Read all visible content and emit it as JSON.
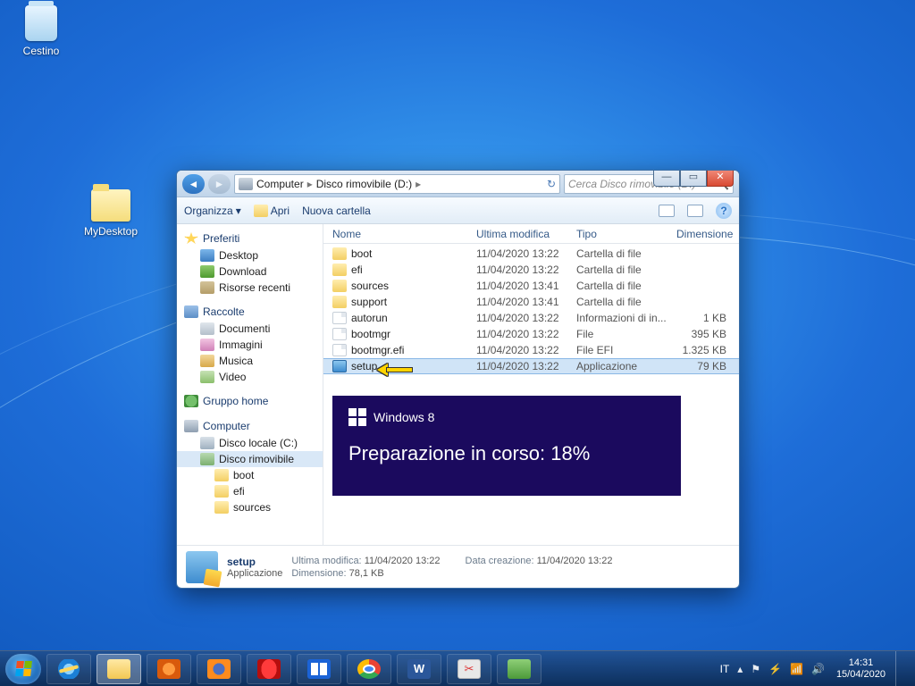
{
  "desktop": {
    "recycle_label": "Cestino",
    "mydesktop_label": "MyDesktop"
  },
  "window": {
    "nav": {
      "computer": "Computer",
      "drive": "Disco rimovibile (D:)"
    },
    "search_placeholder": "Cerca Disco rimovibile (D:)",
    "toolbar": {
      "organize": "Organizza",
      "open": "Apri",
      "new_folder": "Nuova cartella"
    },
    "columns": {
      "name": "Nome",
      "modified": "Ultima modifica",
      "type": "Tipo",
      "size": "Dimensione"
    },
    "sidebar": {
      "favorites": "Preferiti",
      "desktop": "Desktop",
      "download": "Download",
      "recent": "Risorse recenti",
      "libraries": "Raccolte",
      "documents": "Documenti",
      "images": "Immagini",
      "music": "Musica",
      "video": "Video",
      "homegroup": "Gruppo home",
      "computer": "Computer",
      "local_disk": "Disco locale (C:)",
      "removable": "Disco rimovibile",
      "boot": "boot",
      "efi": "efi",
      "sources": "sources"
    },
    "files": [
      {
        "name": "boot",
        "modified": "11/04/2020 13:22",
        "type": "Cartella di file",
        "size": "",
        "icon": "folder"
      },
      {
        "name": "efi",
        "modified": "11/04/2020 13:22",
        "type": "Cartella di file",
        "size": "",
        "icon": "folder"
      },
      {
        "name": "sources",
        "modified": "11/04/2020 13:41",
        "type": "Cartella di file",
        "size": "",
        "icon": "folder"
      },
      {
        "name": "support",
        "modified": "11/04/2020 13:41",
        "type": "Cartella di file",
        "size": "",
        "icon": "folder"
      },
      {
        "name": "autorun",
        "modified": "11/04/2020 13:22",
        "type": "Informazioni di in...",
        "size": "1 KB",
        "icon": "file"
      },
      {
        "name": "bootmgr",
        "modified": "11/04/2020 13:22",
        "type": "File",
        "size": "395 KB",
        "icon": "file"
      },
      {
        "name": "bootmgr.efi",
        "modified": "11/04/2020 13:22",
        "type": "File EFI",
        "size": "1.325 KB",
        "icon": "file"
      },
      {
        "name": "setup",
        "modified": "11/04/2020 13:22",
        "type": "Applicazione",
        "size": "79 KB",
        "icon": "app",
        "selected": true
      }
    ],
    "details": {
      "title": "setup",
      "subtitle": "Applicazione",
      "last_mod_label": "Ultima modifica:",
      "last_mod": "11/04/2020 13:22",
      "size_label": "Dimensione:",
      "size": "78,1 KB",
      "created_label": "Data creazione:",
      "created": "11/04/2020 13:22"
    }
  },
  "overlay": {
    "os": "Windows 8",
    "message_prefix": "Preparazione in corso: ",
    "percent": "18%"
  },
  "taskbar": {
    "lang": "IT",
    "time": "14:31",
    "date": "15/04/2020"
  }
}
